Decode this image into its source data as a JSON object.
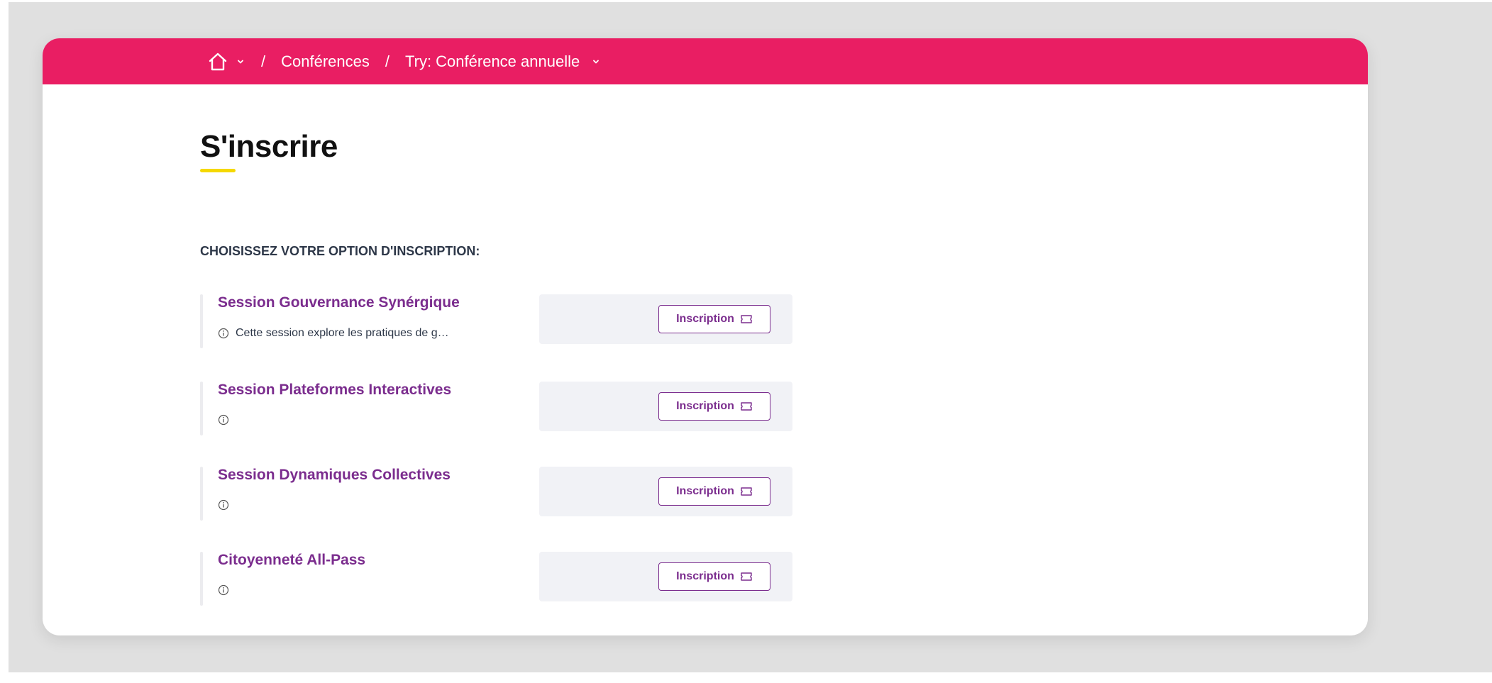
{
  "breadcrumb": {
    "home_icon": "home-icon",
    "conferences": "Conférences",
    "separator": "/",
    "current": "Try: Conférence annuelle"
  },
  "page": {
    "title": "S'inscrire",
    "section_label": "CHOISISSEZ VOTRE OPTION D'INSCRIPTION:"
  },
  "options": [
    {
      "name": "Session Gouvernance Synérgique",
      "description": "Cette session explore les pratiques de g…",
      "button_label": "Inscription"
    },
    {
      "name": "Session Plateformes Interactives",
      "description": "",
      "button_label": "Inscription"
    },
    {
      "name": "Session Dynamiques Collectives",
      "description": "",
      "button_label": "Inscription"
    },
    {
      "name": "Citoyenneté All-Pass",
      "description": "",
      "button_label": "Inscription"
    }
  ],
  "colors": {
    "header": "#e91e63",
    "accent": "#7b2d8e",
    "title_underline": "#f5d800",
    "panel_bg": "#f1f2f6"
  }
}
